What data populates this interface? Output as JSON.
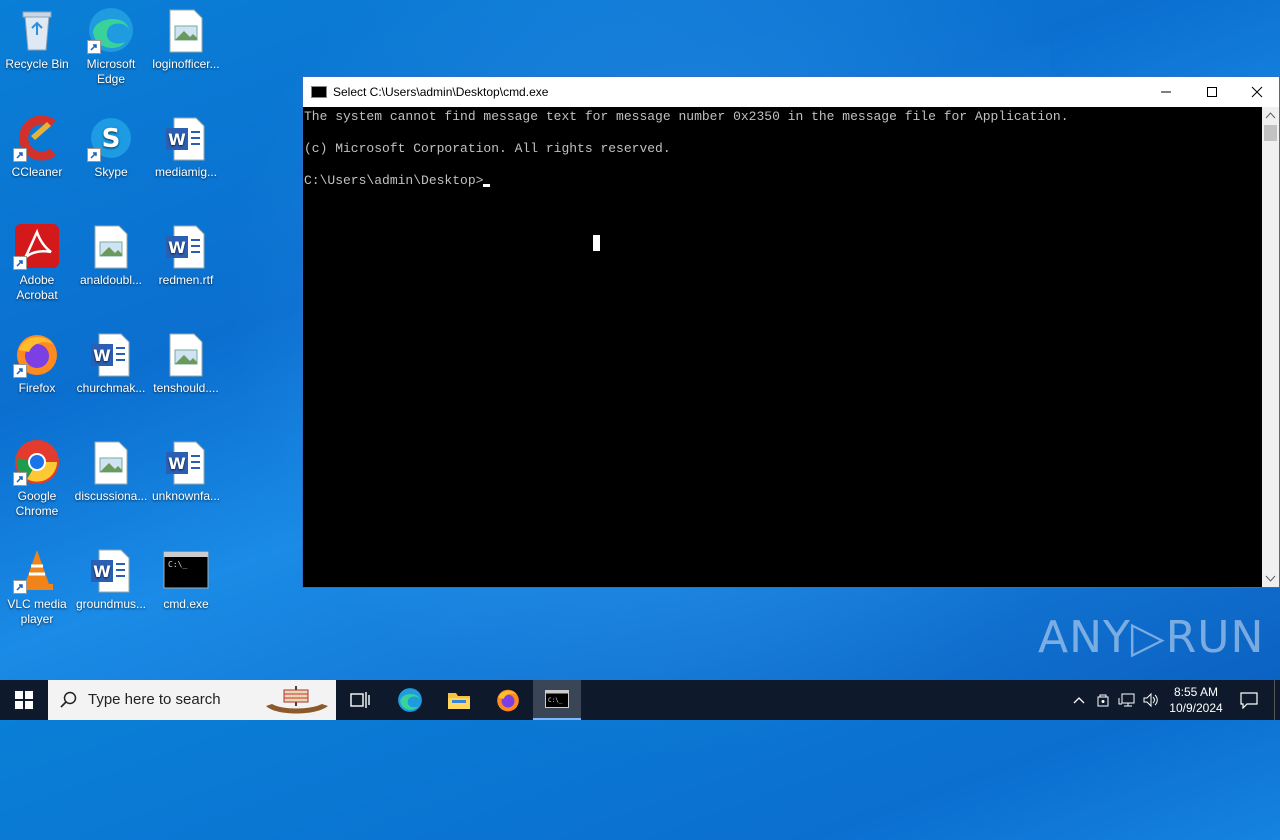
{
  "desktop": {
    "icons": [
      {
        "label": "Recycle Bin",
        "icon": "recycle-bin-icon"
      },
      {
        "label": "Microsoft Edge",
        "icon": "edge-icon"
      },
      {
        "label": "loginofficer...",
        "icon": "image-file-icon"
      },
      {
        "label": "CCleaner",
        "icon": "ccleaner-icon"
      },
      {
        "label": "Skype",
        "icon": "skype-icon"
      },
      {
        "label": "mediamig...",
        "icon": "word-doc-icon"
      },
      {
        "label": "Adobe Acrobat",
        "icon": "acrobat-icon"
      },
      {
        "label": "analdoubl...",
        "icon": "image-file-icon"
      },
      {
        "label": "redmen.rtf",
        "icon": "word-doc-icon"
      },
      {
        "label": "Firefox",
        "icon": "firefox-icon"
      },
      {
        "label": "churchmak...",
        "icon": "word-doc-icon"
      },
      {
        "label": "tenshould....",
        "icon": "image-file-icon"
      },
      {
        "label": "Google Chrome",
        "icon": "chrome-icon"
      },
      {
        "label": "discussiona...",
        "icon": "image-file-icon"
      },
      {
        "label": "unknownfa...",
        "icon": "word-doc-icon"
      },
      {
        "label": "VLC media player",
        "icon": "vlc-icon"
      },
      {
        "label": "groundmus...",
        "icon": "word-doc-icon"
      },
      {
        "label": "cmd.exe",
        "icon": "cmd-icon"
      }
    ]
  },
  "cmd": {
    "title": "Select C:\\Users\\admin\\Desktop\\cmd.exe",
    "lines": [
      "The system cannot find message text for message number 0x2350 in the message file for Application.",
      "(c) Microsoft Corporation. All rights reserved.",
      "C:\\Users\\admin\\Desktop>"
    ]
  },
  "watermark": "ANY▷RUN",
  "taskbar": {
    "search_placeholder": "Type here to search",
    "time": "8:55 AM",
    "date": "10/9/2024"
  },
  "colors": {
    "desktop_bg": "#0b6fd0",
    "taskbar_bg": "#0e1a2b",
    "console_bg": "#000000",
    "console_text": "#c0c0c0"
  }
}
